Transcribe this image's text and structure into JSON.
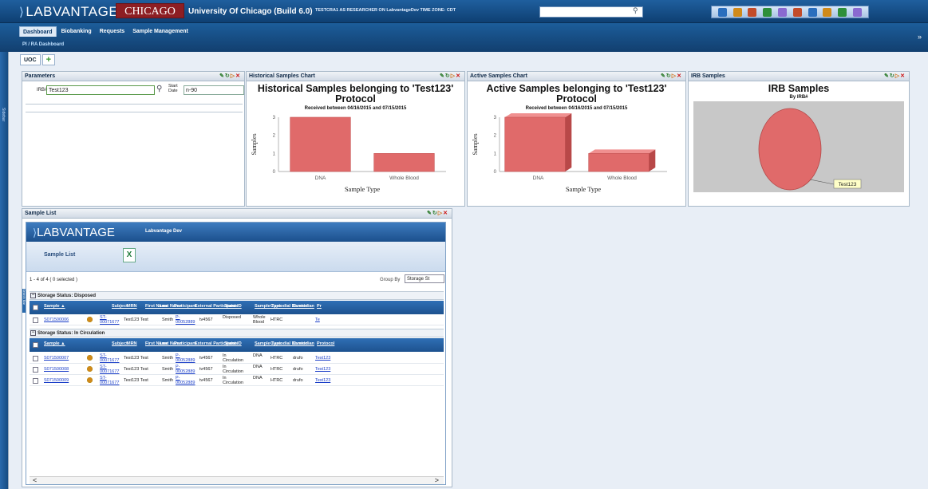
{
  "header": {
    "logo_text": "LABVANTAGE",
    "logo_mark": "®",
    "university_badge": "CHICAGO",
    "app_title": "University Of Chicago (Build 6.0)",
    "user_info": "TESTCRA1 AS RESEARCHER ON LabvantageDev TIME ZONE: CDT",
    "search_value": "",
    "toolbar_icons": [
      "help-icon",
      "edit-icon",
      "tools-icon",
      "people-icon",
      "settings-icon",
      "report-icon",
      "document-icon",
      "user-icon",
      "refresh-icon",
      "chart-icon"
    ]
  },
  "nav": {
    "tabs": [
      "Dashboard",
      "Biobanking",
      "Requests",
      "Sample Management"
    ],
    "sub_item": "PI / RA Dashboard",
    "collapse_glyph": "»"
  },
  "sidebar": {
    "label": "Sidebar"
  },
  "workspace": {
    "tabs": [
      "UOC"
    ],
    "add_glyph": "+"
  },
  "panels": {
    "parameters": {
      "title": "Parameters",
      "irb_label": "IRB#",
      "irb_value": "Test123",
      "start_label_1": "Start",
      "start_label_2": "Date",
      "start_value": "n-90"
    },
    "historical": {
      "title": "Historical Samples Chart"
    },
    "active": {
      "title": "Active Samples Chart"
    },
    "irb": {
      "title": "IRB Samples"
    },
    "sample_list": {
      "title": "Sample List"
    }
  },
  "controls": {
    "edit": "✎",
    "refresh": "↻",
    "move": "▷",
    "close": "✕"
  },
  "chart_data": [
    {
      "type": "bar",
      "title": "Historical Samples belonging to 'Test123' Protocol",
      "subtitle": "Received between 04/16/2015 and 07/15/2015",
      "xlabel": "Sample Type",
      "ylabel": "Samples",
      "categories": [
        "DNA",
        "Whole Blood"
      ],
      "values": [
        3,
        1
      ],
      "y_ticks": [
        "0",
        "1",
        "2",
        "3"
      ],
      "ylim": [
        0,
        3
      ],
      "color": "#e06a6a"
    },
    {
      "type": "bar",
      "title": "Active Samples belonging to 'Test123' Protocol",
      "subtitle": "Received between 04/16/2015 and 07/15/2015",
      "xlabel": "Sample Type",
      "ylabel": "Samples",
      "categories": [
        "DNA",
        "Whole Blood"
      ],
      "values": [
        3,
        1
      ],
      "y_ticks": [
        "0",
        "1",
        "2",
        "3"
      ],
      "ylim": [
        0,
        3
      ],
      "color": "#e06a6a"
    },
    {
      "type": "pie",
      "title": "IRB Samples",
      "subtitle": "By IRB#",
      "slices": [
        {
          "label": "Test123",
          "value": 1
        }
      ],
      "color": "#e06a6a"
    }
  ],
  "sample_list": {
    "logo_text": "LABVANTAGE",
    "instance": "Labvantage Dev",
    "title": "Sample List",
    "excel_label": "X",
    "count_text": "1 - 4 of 4 ( 0 selected )",
    "group_by_label": "Group By",
    "group_by_value": "Storage St",
    "groups": [
      {
        "label": "Storage Status: Disposed",
        "columns": [
          "Sample ▲",
          "Subject",
          "MRN",
          "First Name",
          "Last Name",
          "Participant",
          "External Participant ID",
          "Status",
          "Sample Type",
          "Custodial Domain",
          "Custodian",
          "Pr"
        ],
        "rows": [
          {
            "sample": "S071500006",
            "subject": "ST-00071677",
            "mrn": "",
            "first": "Test123 Test",
            "last": "Smith",
            "participant": "P-00052889",
            "ext": "tv4567",
            "status": "Disposed",
            "type": "Whole Blood",
            "domain": "HTRC",
            "custodian": "",
            "protocol": "Te"
          }
        ]
      },
      {
        "label": "Storage Status: In Circulation",
        "columns": [
          "Sample ▲",
          "Subject",
          "MRN",
          "First Name",
          "Last Name",
          "Participant",
          "External Participant ID",
          "Status",
          "Sample Type",
          "Custodial Domain",
          "Custodian",
          "Protocol"
        ],
        "rows": [
          {
            "sample": "S071500007",
            "subject": "ST-00071677",
            "mrn": "",
            "first": "Test123 Test",
            "last": "Smith",
            "participant": "P-00052889",
            "ext": "tv4567",
            "status": "In Circulation",
            "type": "DNA",
            "domain": "HTRC",
            "custodian": "drufo",
            "protocol": "Test123"
          },
          {
            "sample": "S071500008",
            "subject": "ST-00071677",
            "mrn": "",
            "first": "Test123 Test",
            "last": "Smith",
            "participant": "P-00052889",
            "ext": "tv4567",
            "status": "In Circulation",
            "type": "DNA",
            "domain": "HTRC",
            "custodian": "drufo",
            "protocol": "Test123"
          },
          {
            "sample": "S071500009",
            "subject": "ST-00071677",
            "mrn": "",
            "first": "Test123 Test",
            "last": "Smith",
            "participant": "P-00052889",
            "ext": "tv4567",
            "status": "In Circulation",
            "type": "DNA",
            "domain": "HTRC",
            "custodian": "drufo",
            "protocol": "Test123"
          }
        ]
      }
    ],
    "scroll_left": "<",
    "scroll_right": ">",
    "side_label": "Search Bar"
  }
}
